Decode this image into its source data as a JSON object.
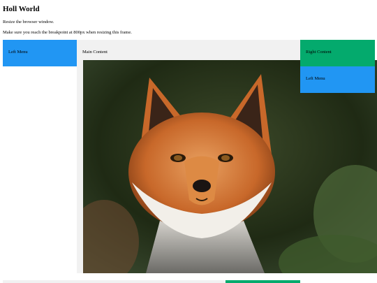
{
  "page": {
    "title": "Holl World",
    "intro_lines": [
      "Resize the browser window.",
      "Make sure you reach the breakpoint at 800px when resizing this frame."
    ]
  },
  "panels": {
    "left_menu": {
      "label": "Left Menu",
      "color": "#2196F3"
    },
    "main_content": {
      "label": "Main Content",
      "color": "#f1f1f1",
      "image": "fox-photo"
    },
    "right_content": {
      "label": "Right Content",
      "color": "#04AA6D"
    },
    "left_menu_duplicate": {
      "label": "Left Menu",
      "color": "#2196F3"
    }
  }
}
